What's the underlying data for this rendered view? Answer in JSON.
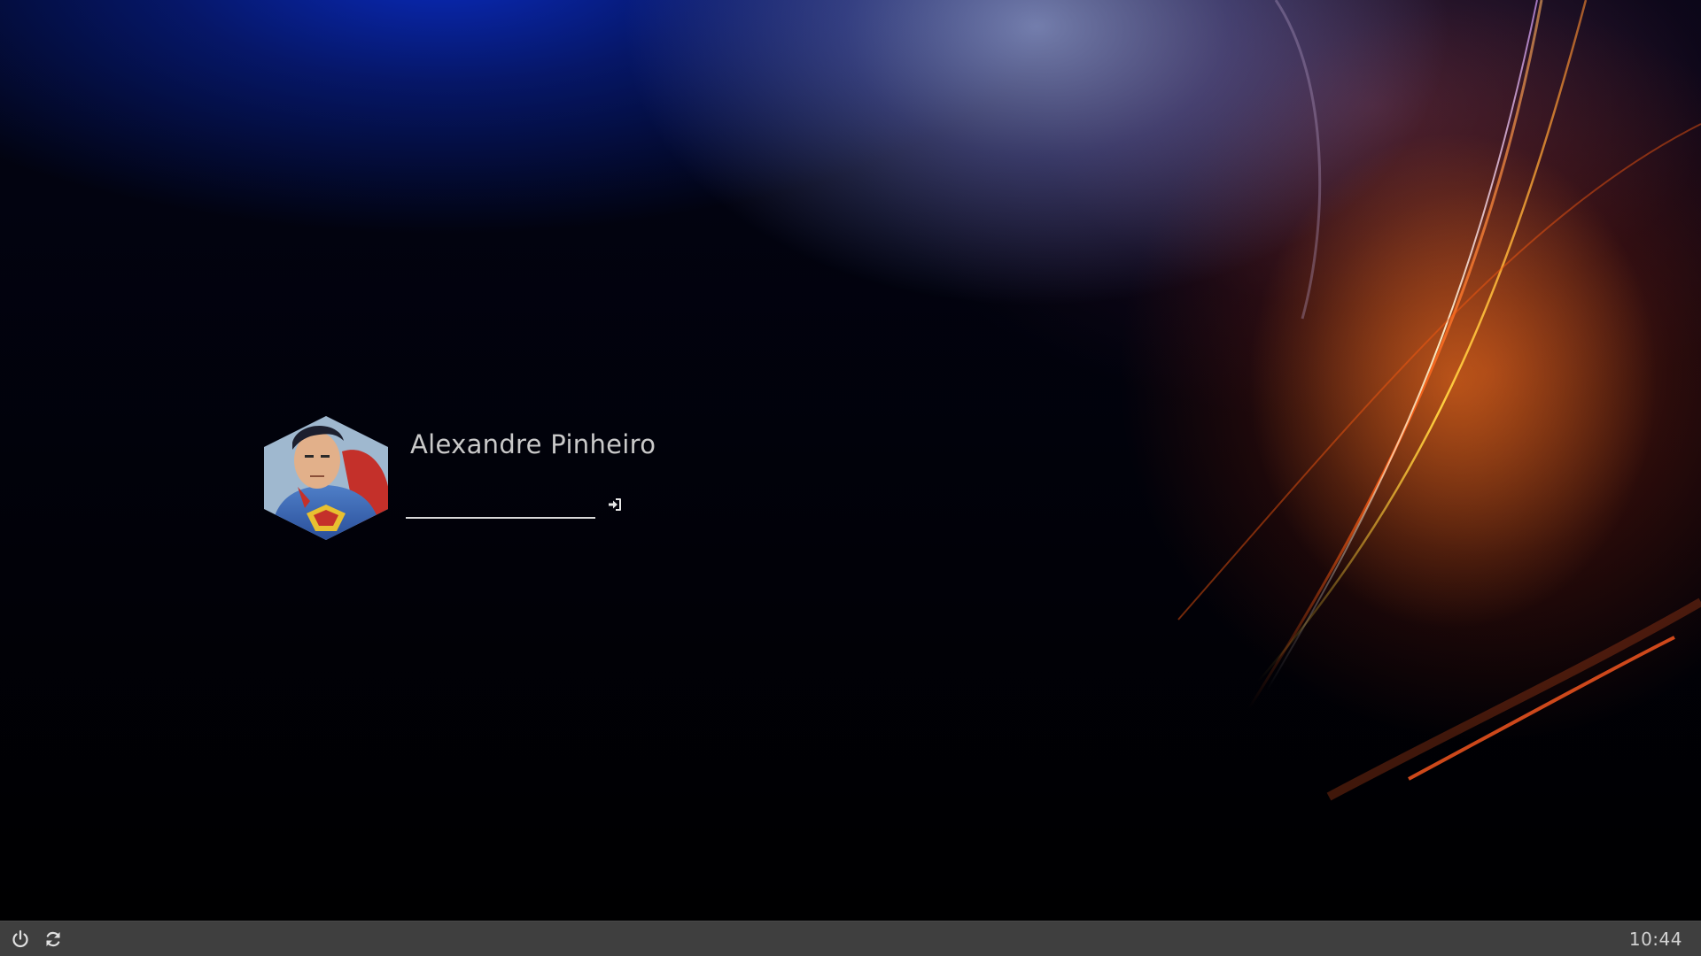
{
  "user": {
    "name": "Alexandre Pinheiro",
    "avatar_icon": "superman-avatar"
  },
  "login": {
    "password_value": "",
    "password_placeholder": "",
    "submit_icon": "sign-in-icon"
  },
  "panel": {
    "power_icon": "power-icon",
    "restart_icon": "restart-icon",
    "clock": "10:44"
  },
  "colors": {
    "panel_background": "#3f3f3f",
    "username_text": "#c9c9c9",
    "field_underline": "#d8d8d8",
    "clock_text": "#d2d2d2"
  }
}
